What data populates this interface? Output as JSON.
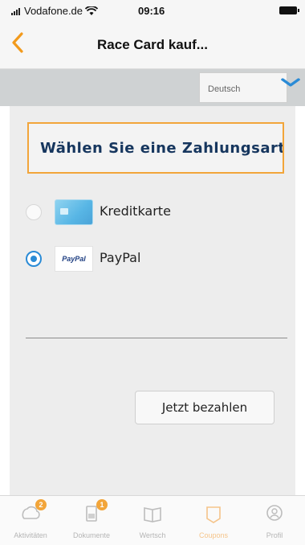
{
  "status_bar": {
    "carrier": "Vodafone.de",
    "time": "09:16"
  },
  "nav": {
    "title": "Race Card kauf..."
  },
  "language": {
    "selected": "Deutsch"
  },
  "payment": {
    "heading": "Wählen Sie eine Zahlungsart",
    "options": [
      {
        "label": "Kreditkarte",
        "selected": false,
        "icon": "credit-card-icon"
      },
      {
        "label": "PayPal",
        "selected": true,
        "icon": "paypal-logo"
      }
    ],
    "paypal_logo_text": "PayPal",
    "pay_button": "Jetzt bezahlen"
  },
  "tabs": [
    {
      "label": "Aktivitäten",
      "icon": "activity-icon",
      "badge": "2"
    },
    {
      "label": "Dokumente",
      "icon": "documents-icon",
      "badge": "1"
    },
    {
      "label": "Wertsch",
      "icon": "book-icon"
    },
    {
      "label": "Coupons",
      "icon": "coupon-icon",
      "active": true
    },
    {
      "label": "Profil",
      "icon": "profile-icon"
    }
  ],
  "colors": {
    "accent": "#f29a1c",
    "heading_border": "#f2a53a",
    "heading_text": "#16365e",
    "radio_selected": "#2a8bd6"
  }
}
